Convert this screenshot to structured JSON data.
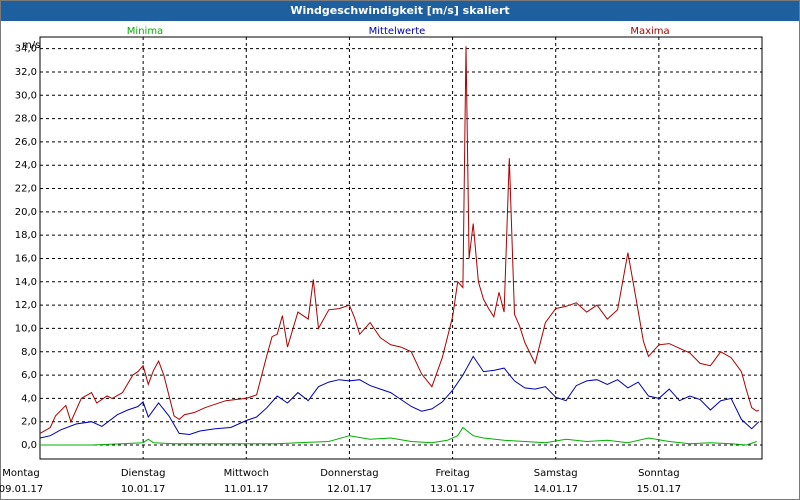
{
  "window": {
    "title": "Windgeschwindigkeit [m/s] skaliert"
  },
  "colors": {
    "background": "#ffffff",
    "titlebar": "#1e5fa0",
    "minima": "#00b000",
    "mittelwerte": "#0000b4",
    "maxima": "#b00000",
    "grid": "#000000"
  },
  "chart_data": {
    "type": "line",
    "title": "Windgeschwindigkeit [m/s] skaliert",
    "ylabel": "m/s",
    "xlabel": "",
    "ylim": [
      -1.2,
      35.0
    ],
    "yticks": [
      0.0,
      2.0,
      4.0,
      6.0,
      8.0,
      10.0,
      12.0,
      14.0,
      16.0,
      18.0,
      20.0,
      22.0,
      24.0,
      26.0,
      28.0,
      30.0,
      32.0,
      34.0
    ],
    "ytick_labels": [
      "0,0",
      "2,0",
      "4,0",
      "6,0",
      "8,0",
      "10,0",
      "12,0",
      "14,0",
      "16,0",
      "18,0",
      "20,0",
      "22,0",
      "24,0",
      "26,0",
      "28,0",
      "30,0",
      "32,0",
      "34,0"
    ],
    "xlim": [
      0,
      7
    ],
    "day_ticks": [
      0,
      1,
      2,
      3,
      4,
      5,
      6
    ],
    "day_labels": [
      {
        "day": "Montag",
        "date": "09.01.17"
      },
      {
        "day": "Dienstag",
        "date": "10.01.17"
      },
      {
        "day": "Mittwoch",
        "date": "11.01.17"
      },
      {
        "day": "Donnerstag",
        "date": "12.01.17"
      },
      {
        "day": "Freitag",
        "date": "13.01.17"
      },
      {
        "day": "Samstag",
        "date": "14.01.17"
      },
      {
        "day": "Sonntag",
        "date": "15.01.17"
      }
    ],
    "grid": true,
    "legend_position": "top",
    "series": [
      {
        "name": "Minima",
        "x": [
          0,
          0.5,
          0.8,
          1.0,
          1.05,
          1.1,
          1.3,
          1.6,
          2.0,
          2.3,
          2.5,
          2.8,
          3.0,
          3.2,
          3.4,
          3.6,
          3.8,
          3.95,
          4.05,
          4.1,
          4.2,
          4.3,
          4.5,
          4.7,
          4.9,
          5.1,
          5.3,
          5.5,
          5.7,
          5.9,
          6.1,
          6.3,
          6.5,
          6.7,
          6.85,
          6.95
        ],
        "values": [
          0.0,
          0.0,
          0.1,
          0.2,
          0.5,
          0.2,
          0.1,
          0.1,
          0.1,
          0.1,
          0.2,
          0.3,
          0.8,
          0.5,
          0.6,
          0.3,
          0.2,
          0.4,
          0.8,
          1.5,
          0.8,
          0.6,
          0.4,
          0.3,
          0.2,
          0.5,
          0.3,
          0.4,
          0.2,
          0.6,
          0.3,
          0.1,
          0.2,
          0.1,
          0.0,
          0.3
        ]
      },
      {
        "name": "Mittelwerte",
        "x": [
          0,
          0.1,
          0.2,
          0.35,
          0.5,
          0.6,
          0.75,
          0.85,
          0.95,
          1.0,
          1.05,
          1.15,
          1.25,
          1.35,
          1.45,
          1.55,
          1.7,
          1.85,
          2.0,
          2.1,
          2.2,
          2.3,
          2.4,
          2.5,
          2.6,
          2.7,
          2.8,
          2.9,
          3.0,
          3.1,
          3.2,
          3.3,
          3.4,
          3.5,
          3.6,
          3.7,
          3.8,
          3.9,
          4.0,
          4.1,
          4.2,
          4.3,
          4.4,
          4.5,
          4.6,
          4.7,
          4.8,
          4.9,
          5.0,
          5.1,
          5.2,
          5.3,
          5.4,
          5.5,
          5.6,
          5.7,
          5.8,
          5.9,
          6.0,
          6.1,
          6.2,
          6.3,
          6.4,
          6.5,
          6.6,
          6.7,
          6.8,
          6.9,
          6.97
        ],
        "values": [
          0.6,
          0.8,
          1.3,
          1.8,
          2.0,
          1.6,
          2.6,
          3.0,
          3.3,
          3.7,
          2.4,
          3.6,
          2.5,
          1.0,
          0.9,
          1.2,
          1.4,
          1.5,
          2.1,
          2.4,
          3.2,
          4.2,
          3.6,
          4.5,
          3.8,
          5.0,
          5.4,
          5.6,
          5.5,
          5.6,
          5.1,
          4.8,
          4.5,
          3.9,
          3.3,
          2.9,
          3.1,
          3.7,
          4.7,
          6.0,
          7.6,
          6.3,
          6.4,
          6.6,
          5.5,
          4.9,
          4.8,
          5.0,
          4.1,
          3.8,
          5.1,
          5.5,
          5.6,
          5.2,
          5.6,
          4.9,
          5.4,
          4.2,
          4.0,
          4.8,
          3.8,
          4.2,
          3.9,
          3.0,
          3.8,
          4.0,
          2.2,
          1.4,
          2.0
        ]
      },
      {
        "name": "Maxima",
        "x": [
          0,
          0.1,
          0.15,
          0.25,
          0.3,
          0.4,
          0.5,
          0.55,
          0.65,
          0.7,
          0.8,
          0.9,
          0.95,
          1.0,
          1.05,
          1.1,
          1.15,
          1.2,
          1.3,
          1.35,
          1.4,
          1.5,
          1.6,
          1.7,
          1.8,
          1.9,
          2.0,
          2.1,
          2.2,
          2.25,
          2.3,
          2.35,
          2.4,
          2.5,
          2.6,
          2.65,
          2.7,
          2.8,
          2.9,
          3.0,
          3.05,
          3.1,
          3.2,
          3.3,
          3.4,
          3.5,
          3.6,
          3.7,
          3.8,
          3.9,
          4.0,
          4.05,
          4.1,
          4.13,
          4.16,
          4.2,
          4.25,
          4.3,
          4.35,
          4.4,
          4.45,
          4.5,
          4.55,
          4.6,
          4.65,
          4.7,
          4.75,
          4.8,
          4.9,
          5.0,
          5.1,
          5.2,
          5.3,
          5.4,
          5.5,
          5.6,
          5.7,
          5.8,
          5.85,
          5.9,
          6.0,
          6.1,
          6.2,
          6.3,
          6.4,
          6.5,
          6.6,
          6.7,
          6.8,
          6.85,
          6.9,
          6.95,
          6.97
        ],
        "values": [
          1.0,
          1.5,
          2.5,
          3.4,
          2.0,
          4.0,
          4.5,
          3.6,
          4.2,
          4.0,
          4.5,
          6.0,
          6.3,
          6.8,
          5.2,
          6.4,
          7.2,
          6.0,
          2.5,
          2.2,
          2.6,
          2.8,
          3.2,
          3.5,
          3.8,
          3.9,
          4.0,
          4.3,
          7.7,
          9.3,
          9.5,
          11.1,
          8.4,
          11.4,
          10.8,
          14.2,
          10.0,
          11.6,
          11.7,
          12.0,
          10.9,
          9.5,
          10.5,
          9.2,
          8.6,
          8.4,
          8.0,
          6.1,
          5.0,
          7.5,
          11.0,
          14.0,
          13.5,
          34.2,
          16.0,
          19.0,
          14.0,
          12.5,
          11.7,
          11.0,
          13.1,
          11.4,
          24.6,
          11.2,
          10.2,
          8.8,
          7.9,
          7.0,
          10.5,
          11.7,
          11.9,
          12.2,
          11.4,
          12.0,
          10.8,
          11.6,
          16.5,
          11.5,
          8.9,
          7.6,
          8.6,
          8.7,
          8.3,
          7.9,
          7.0,
          6.8,
          8.0,
          7.5,
          6.3,
          4.7,
          3.2,
          2.9,
          3.0
        ]
      }
    ]
  }
}
